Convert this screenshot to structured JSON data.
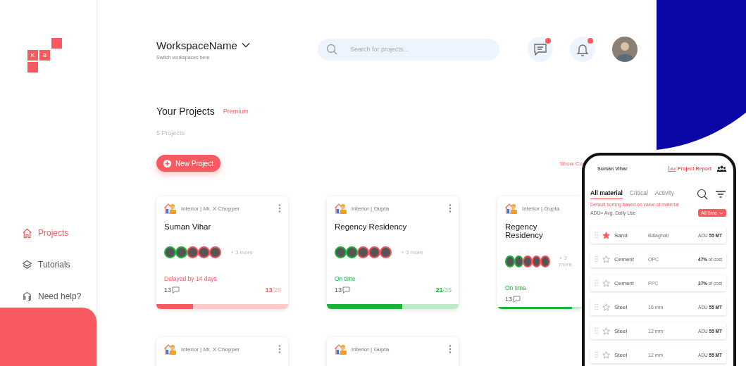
{
  "logo": {
    "letters": [
      "K",
      "B"
    ]
  },
  "nav": [
    {
      "label": "Projects",
      "selected": true
    },
    {
      "label": "Tutorials",
      "selected": false
    },
    {
      "label": "Need help?",
      "selected": false
    }
  ],
  "workspace": {
    "name": "WorkspaceName",
    "hint": "Switch workspaces here"
  },
  "search": {
    "placeholder": "Search for projects..."
  },
  "header_icons": [
    {
      "kind": "chat",
      "unread": true
    },
    {
      "kind": "bell",
      "unread": true
    }
  ],
  "section": {
    "title": "Your Projects",
    "badge": "Premium",
    "count": "5 Projects",
    "new_button": "New Project",
    "show_link": "Show Co"
  },
  "projects": [
    {
      "meta": "Interior | Mr. X Chopper",
      "title": "Suman Vihar",
      "members": [
        {
          "color": "#19b33a"
        },
        {
          "color": "#19b33a"
        },
        {
          "color": "#f0545a"
        },
        {
          "color": "#f0545a"
        },
        {
          "color": "#f0545a"
        }
      ],
      "more": "+ 3 more",
      "status": "Delayed by 14 days",
      "kind": "delayed",
      "comments": "13",
      "done": "13",
      "total": "/29",
      "level": 0.28
    },
    {
      "meta": "Interior | Gupta",
      "title": "Regency Residency",
      "members": [
        {
          "color": "#19b33a"
        },
        {
          "color": "#19b33a"
        },
        {
          "color": "#f0545a"
        },
        {
          "color": "#f0545a"
        },
        {
          "color": "#f0545a"
        }
      ],
      "more": "+ 3 more",
      "status": "On time",
      "kind": "ontime",
      "comments": "13",
      "done": "21",
      "total": "/35",
      "level": 0.57
    },
    {
      "meta": "Interior | Gupta",
      "title": "Regency Residency",
      "members": [
        {
          "color": "#19b33a"
        },
        {
          "color": "#19b33a"
        },
        {
          "color": "#f0545a"
        },
        {
          "color": "#f0545a"
        },
        {
          "color": "#f0545a"
        }
      ],
      "more": "+ 3 more",
      "status": "On time",
      "kind": "ontime",
      "comments": "13",
      "level": 0.88
    }
  ],
  "projects_row2": [
    {
      "meta": "Interior | Mr. X Chopper"
    },
    {
      "meta": "Interior | Gupta"
    }
  ],
  "phone": {
    "project": "Suman Vihar",
    "report": "Project Report",
    "tabs": [
      {
        "label": "All material",
        "selected": true
      },
      {
        "label": "Critical",
        "selected": false
      },
      {
        "label": "Activity",
        "selected": false
      }
    ],
    "note": "Default sorting based on value of material",
    "legend": "ADU= Avg. Daily Use",
    "period": "All time",
    "materials": [
      {
        "name": "Sand",
        "spec": "Balaghati",
        "prefix": "ADU",
        "value": "55 MT",
        "starred": true
      },
      {
        "name": "Cement",
        "spec": "OPC",
        "value": "47%",
        "suffix": "of cost",
        "starred": false
      },
      {
        "name": "Cement",
        "spec": "PPC",
        "value": "27%",
        "suffix": "of cost",
        "starred": false
      },
      {
        "name": "Steel",
        "spec": "16 mm",
        "prefix": "ADU",
        "value": "55 MT",
        "starred": false
      },
      {
        "name": "Steel",
        "spec": "12 mm",
        "prefix": "ADU",
        "value": "55 MT",
        "starred": false
      },
      {
        "name": "Steel",
        "spec": "12 mm",
        "prefix": "ADU",
        "value": "55 MT",
        "starred": false
      }
    ]
  }
}
